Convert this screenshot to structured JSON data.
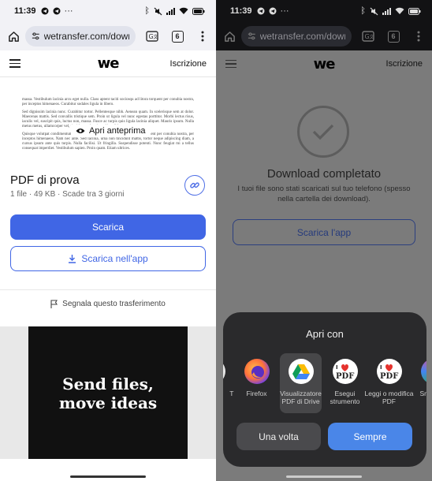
{
  "left": {
    "status": {
      "time": "11:39",
      "dots": "···"
    },
    "browser": {
      "url": "wetransfer.com/downlo",
      "tab_count": "6"
    },
    "header": {
      "logo": "we",
      "signup": "Iscrizione"
    },
    "preview": {
      "overlay": "Apri anteprima",
      "paragraphs": [
        "massa. Vestibulum lacinia arcu eget nulla. Class aptent taciti sociosqu ad litora torquent per conubia nostra, per inceptos himenaeos. Curabitur sodales ligula in libero.",
        "Sed dignissim lacinia nunc. Curabitur tortor. Pellentesque nibh. Aenean quam. In scelerisque sem at dolor. Maecenas mattis. Sed convallis tristique sem. Proin ut ligula vel nunc egestas porttitor. Morbi lectus risus, iaculis vel, suscipit quis, luctus non, massa. Fusce ac turpis quis ligula lacinia aliquet. Mauris ipsum. Nulla metus metus, ullamcorper vel, tincidunt sed, euismod in, nibh.",
        "Quisque volutpat condimentum velit. Class aptent taciti sociosqu ad litora torquent per conubia nostra, per inceptos himenaeos. Nam nec ante. Sed lacinia, urna non tincidunt mattis, tortor neque adipiscing diam, a cursus ipsum ante quis turpis. Nulla facilisi. Ut fringilla. Suspendisse potenti. Nunc feugiat mi a tellus consequat imperdiet. Vestibulum sapien. Proin quam. Etiam ultrices."
      ]
    },
    "file": {
      "title": "PDF di prova",
      "meta": "1 file · 49 KB · Scade tra 3 giorni"
    },
    "buttons": {
      "download": "Scarica",
      "download_app": "Scarica nell'app"
    },
    "report": "Segnala questo trasferimento",
    "ad": {
      "line1": "Send files,",
      "line2": "move ideas"
    }
  },
  "right": {
    "status": {
      "time": "11:39",
      "dots": "···"
    },
    "browser": {
      "url": "wetransfer.com/downlo",
      "tab_count": "6"
    },
    "header": {
      "logo": "we",
      "signup": "Iscrizione"
    },
    "completed": {
      "title": "Download completato",
      "desc": "I tuoi file sono stati scaricati sul tuo telefono (spesso nella cartella dei download).",
      "button": "Scarica l'app"
    },
    "sheet": {
      "title": "Apri con",
      "apps": [
        {
          "label": "T",
          "icon": "partial-app-icon"
        },
        {
          "label": "Firefox",
          "icon": "firefox-icon"
        },
        {
          "label": "Visualizzatore PDF di Drive",
          "icon": "google-drive-icon"
        },
        {
          "label": "Esegui strumento",
          "icon": "ilovepdf-icon"
        },
        {
          "label": "Leggi o modifica PDF",
          "icon": "ilovepdf-icon"
        },
        {
          "label": "Sm",
          "icon": "partial-app-icon"
        }
      ],
      "once": "Una volta",
      "always": "Sempre"
    }
  },
  "colors": {
    "accent": "#4066e5",
    "sheet_primary": "#4a86e8"
  }
}
